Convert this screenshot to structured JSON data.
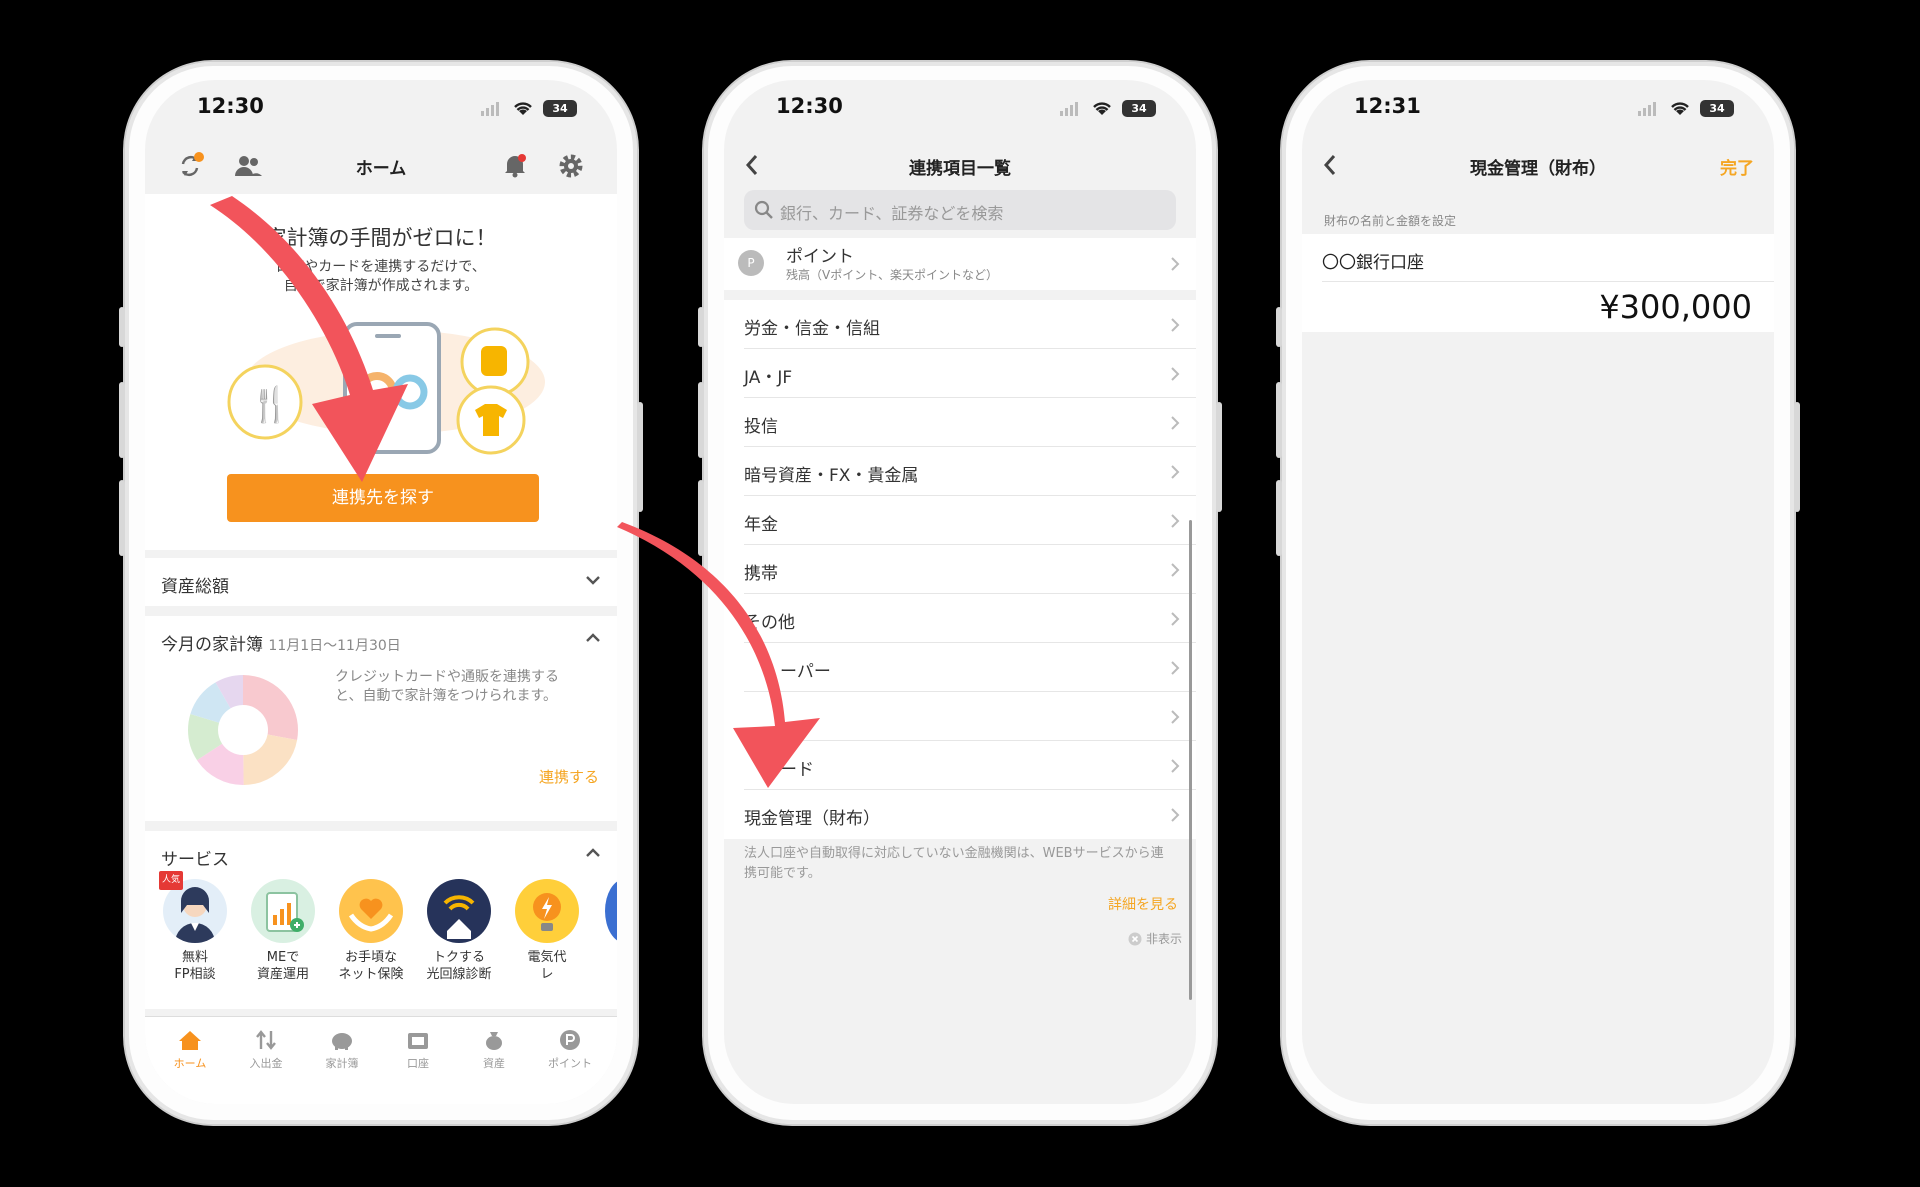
{
  "status": {
    "time1": "12:30",
    "time2": "12:30",
    "time3": "12:31",
    "battery": "34"
  },
  "home": {
    "title": "ホーム",
    "hero_title": "家計簿の手間がゼロに！",
    "hero_sub1": "口座やカードを連携するだけで、",
    "hero_sub2": "自動で家計簿が作成されます。",
    "cta": "連携先を探す",
    "assets_title": "資産総額",
    "month_title": "今月の家計簿",
    "month_range": "11月1日〜11月30日",
    "month_desc1": "クレジットカードや通販を連携する",
    "month_desc2": "と、自動で家計簿をつけられます。",
    "month_link": "連携する",
    "services_title": "サービス",
    "popular_badge": "人気",
    "services": [
      {
        "l1": "無料",
        "l2": "FP相談"
      },
      {
        "l1": "MEで",
        "l2": "資産運用"
      },
      {
        "l1": "お手頃な",
        "l2": "ネット保険"
      },
      {
        "l1": "トクする",
        "l2": "光回線診断"
      },
      {
        "l1": "電気代",
        "l2": "レ"
      }
    ],
    "tabs": [
      "ホーム",
      "入出金",
      "家計簿",
      "口座",
      "資産",
      "ポイント"
    ]
  },
  "link_list": {
    "title": "連携項目一覧",
    "search_placeholder": "銀行、カード、証券などを検索",
    "point_label": "ポイント",
    "point_sub": "残高（Vポイント、楽天ポイントなど）",
    "point_icon_letter": "P",
    "items": [
      "労金・信金・信組",
      "JA・JF",
      "投信",
      "暗号資産・FX・貴金属",
      "年金",
      "携帯",
      "その他",
      "ーパー",
      "",
      "ード",
      "現金管理（財布）"
    ],
    "footnote": "法人口座や自動取得に対応していない金融機関は、WEBサービスから連携可能です。",
    "details_link": "詳細を見る",
    "hide_label": "非表示"
  },
  "wallet": {
    "title": "現金管理（財布）",
    "done": "完了",
    "section_label": "財布の名前と金額を設定",
    "wallet_name": "〇〇銀行口座",
    "amount": "¥300,000"
  },
  "colors": {
    "accent": "#f7921e",
    "arrow": "#f2545b",
    "link": "#f5a623"
  }
}
